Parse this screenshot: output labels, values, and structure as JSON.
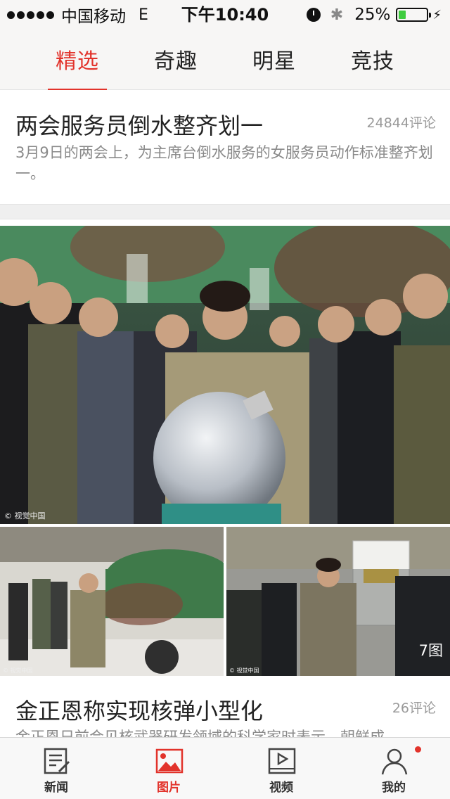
{
  "status_bar": {
    "carrier": "中国移动",
    "network": "E",
    "time": "下午10:40",
    "battery_percent_text": "25%",
    "battery_level": 0.25,
    "icons": [
      "signal-dots-icon",
      "alarm-icon",
      "bluetooth-icon",
      "battery-icon",
      "charging-icon"
    ]
  },
  "tabs": [
    {
      "label": "精选",
      "active": true
    },
    {
      "label": "奇趣",
      "active": false
    },
    {
      "label": "明星",
      "active": false
    },
    {
      "label": "竞技",
      "active": false
    }
  ],
  "articles": [
    {
      "title": "两会服务员倒水整齐划一",
      "comments": "24844评论",
      "description": "3月9日的两会上，为主席台倒水服务的女服务员动作标准整齐划一。"
    },
    {
      "title": "金正恩称实现核弹小型化",
      "comments": "26评论",
      "description": "金正恩日前会见核武器研发领域的科学家时表示，朝鲜成",
      "photos": {
        "credit_main": "© 视觉中国",
        "credit_small": "© 视觉中国",
        "count_label": "7图"
      }
    }
  ],
  "bottom_nav": [
    {
      "label": "新闻",
      "icon": "news-icon",
      "active": false
    },
    {
      "label": "图片",
      "icon": "picture-icon",
      "active": true
    },
    {
      "label": "视频",
      "icon": "video-icon",
      "active": false
    },
    {
      "label": "我的",
      "icon": "profile-icon",
      "active": false,
      "badge": true
    }
  ],
  "colors": {
    "accent": "#e2332b",
    "battery_fill": "#3fcc3f"
  }
}
